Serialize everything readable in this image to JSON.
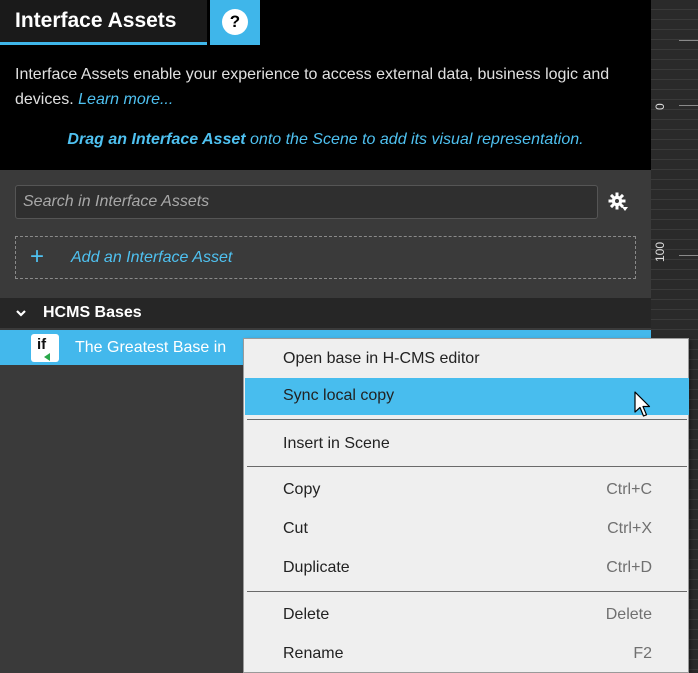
{
  "panel": {
    "title": "Interface Assets",
    "help_label": "?",
    "description": "Interface Assets enable your experience to access external data, business logic and devices.",
    "learn_more": "Learn more...",
    "drag_bold": "Drag an Interface Asset",
    "drag_rest": "onto the Scene to add its visual representation."
  },
  "search": {
    "placeholder": "Search in Interface Assets"
  },
  "add_asset": {
    "plus": "+",
    "label": "Add an Interface Asset"
  },
  "group": {
    "label": "HCMS Bases"
  },
  "asset_row": {
    "icon_text": "if",
    "label": "The Greatest Base in"
  },
  "ruler": {
    "labels": [
      "0",
      "100"
    ]
  },
  "context_menu": {
    "items": [
      {
        "label": "Open base in H-CMS editor",
        "shortcut": ""
      },
      {
        "label": "Sync local copy",
        "shortcut": ""
      },
      {
        "label": "Insert in Scene",
        "shortcut": ""
      },
      {
        "label": "Copy",
        "shortcut": "Ctrl+C"
      },
      {
        "label": "Cut",
        "shortcut": "Ctrl+X"
      },
      {
        "label": "Duplicate",
        "shortcut": "Ctrl+D"
      },
      {
        "label": "Delete",
        "shortcut": "Delete"
      },
      {
        "label": "Rename",
        "shortcut": "F2"
      }
    ]
  },
  "colors": {
    "accent": "#3fb6ea",
    "panel_bg": "#3a3a3a",
    "menu_bg": "#efefef"
  },
  "icons": {
    "help": "help-icon",
    "settings": "gear-icon",
    "expand": "chevron-down-icon",
    "asset": "interface-asset-icon",
    "cursor": "mouse-pointer-icon"
  }
}
